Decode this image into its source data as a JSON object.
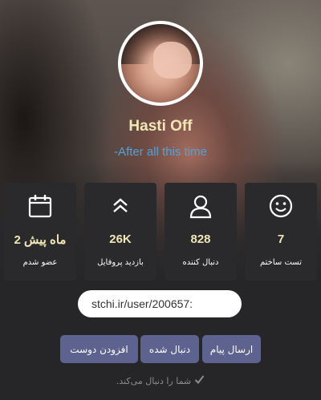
{
  "profile": {
    "name": "Hasti Off",
    "bio": "-After all this time"
  },
  "stats": [
    {
      "icon": "smiley-icon",
      "value": "7",
      "label": "تست ساختم"
    },
    {
      "icon": "user-icon",
      "value": "828",
      "label": "دنبال کننده"
    },
    {
      "icon": "double-chevron-up-icon",
      "value": "26K",
      "label": "بازدید پروفایل"
    },
    {
      "icon": "calendar-icon",
      "value": "2 ماه پیش",
      "label": "عضو شدم"
    }
  ],
  "profile_link": "stchi.ir/user/200657:",
  "actions": {
    "send_message": "ارسال پیام",
    "followed": "دنبال شده",
    "add_friend": "افزودن دوست"
  },
  "follow_note": "شما را دنبال می‌کند.",
  "colors": {
    "accent_gold": "#f1e6b6",
    "bio_blue": "#4fa3dc",
    "button": "#5d628f",
    "card": "#2a2a2c"
  }
}
